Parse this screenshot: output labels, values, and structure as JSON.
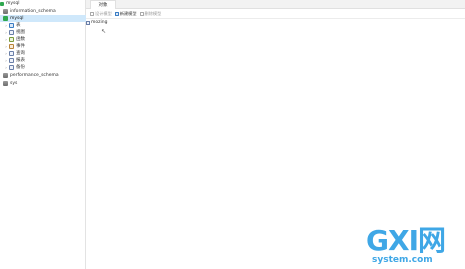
{
  "sidebar": {
    "connection": "mysql",
    "databases": [
      {
        "name": "information_schema",
        "selected": false
      },
      {
        "name": "mysql",
        "selected": true
      },
      {
        "name": "performance_schema",
        "selected": false
      },
      {
        "name": "sys",
        "selected": false
      }
    ],
    "children": [
      {
        "label": "表",
        "icon": "table-icon"
      },
      {
        "label": "视图",
        "icon": "view-icon"
      },
      {
        "label": "函数",
        "icon": "function-icon"
      },
      {
        "label": "事件",
        "icon": "event-icon"
      },
      {
        "label": "查询",
        "icon": "query-icon"
      },
      {
        "label": "报表",
        "icon": "report-icon"
      },
      {
        "label": "备份",
        "icon": "backup-icon"
      }
    ]
  },
  "main": {
    "tab": "对象",
    "toolbar": [
      {
        "label": "设计模型",
        "active": false
      },
      {
        "label": "新建模型",
        "active": true
      },
      {
        "label": "删除模型",
        "active": false
      }
    ],
    "item": "mozing"
  },
  "watermark": {
    "logo": "GXI网",
    "sub": "system.com"
  }
}
